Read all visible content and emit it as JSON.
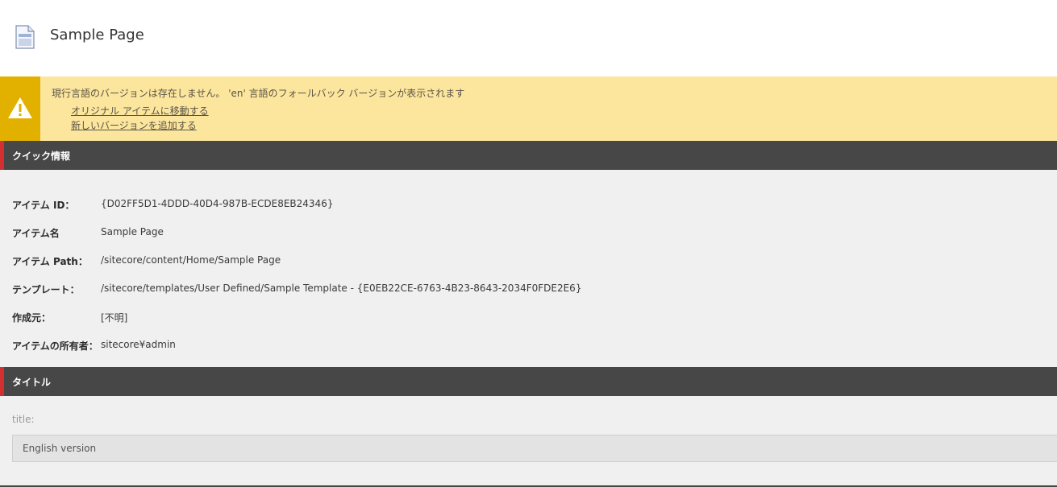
{
  "header": {
    "icon": "document-icon",
    "title": "Sample Page"
  },
  "warning": {
    "icon": "warning-icon",
    "message": "現行言語のバージョンは存在しません。 'en' 言語のフォールバック バージョンが表示されます",
    "links": [
      "オリジナル アイテムに移動する",
      "新しいバージョンを追加する"
    ],
    "colors": {
      "background": "#fce69e",
      "icon_background": "#e2b100"
    }
  },
  "quick_info": {
    "title": "クイック情報",
    "rows": [
      {
        "label": "アイテム ID：",
        "value": "{D02FF5D1-4DDD-40D4-987B-ECDE8EB24346}"
      },
      {
        "label": "アイテム名",
        "value": "Sample Page"
      },
      {
        "label": "アイテム Path：",
        "value": "/sitecore/content/Home/Sample Page"
      },
      {
        "label": "テンプレート：",
        "value": "/sitecore/templates/User Defined/Sample Template - {E0EB22CE-6763-4B23-8643-2034F0FDE2E6}"
      },
      {
        "label": "作成元：",
        "value": "[不明]"
      },
      {
        "label": "アイテムの所有者：",
        "value": "sitecore¥admin"
      }
    ]
  },
  "title_section": {
    "title": "タイトル",
    "field_label": "title:",
    "field_value": "English version"
  },
  "colors": {
    "section_header": "#474747",
    "section_accent": "#d32f2f",
    "content_background": "#f0f0f0"
  }
}
